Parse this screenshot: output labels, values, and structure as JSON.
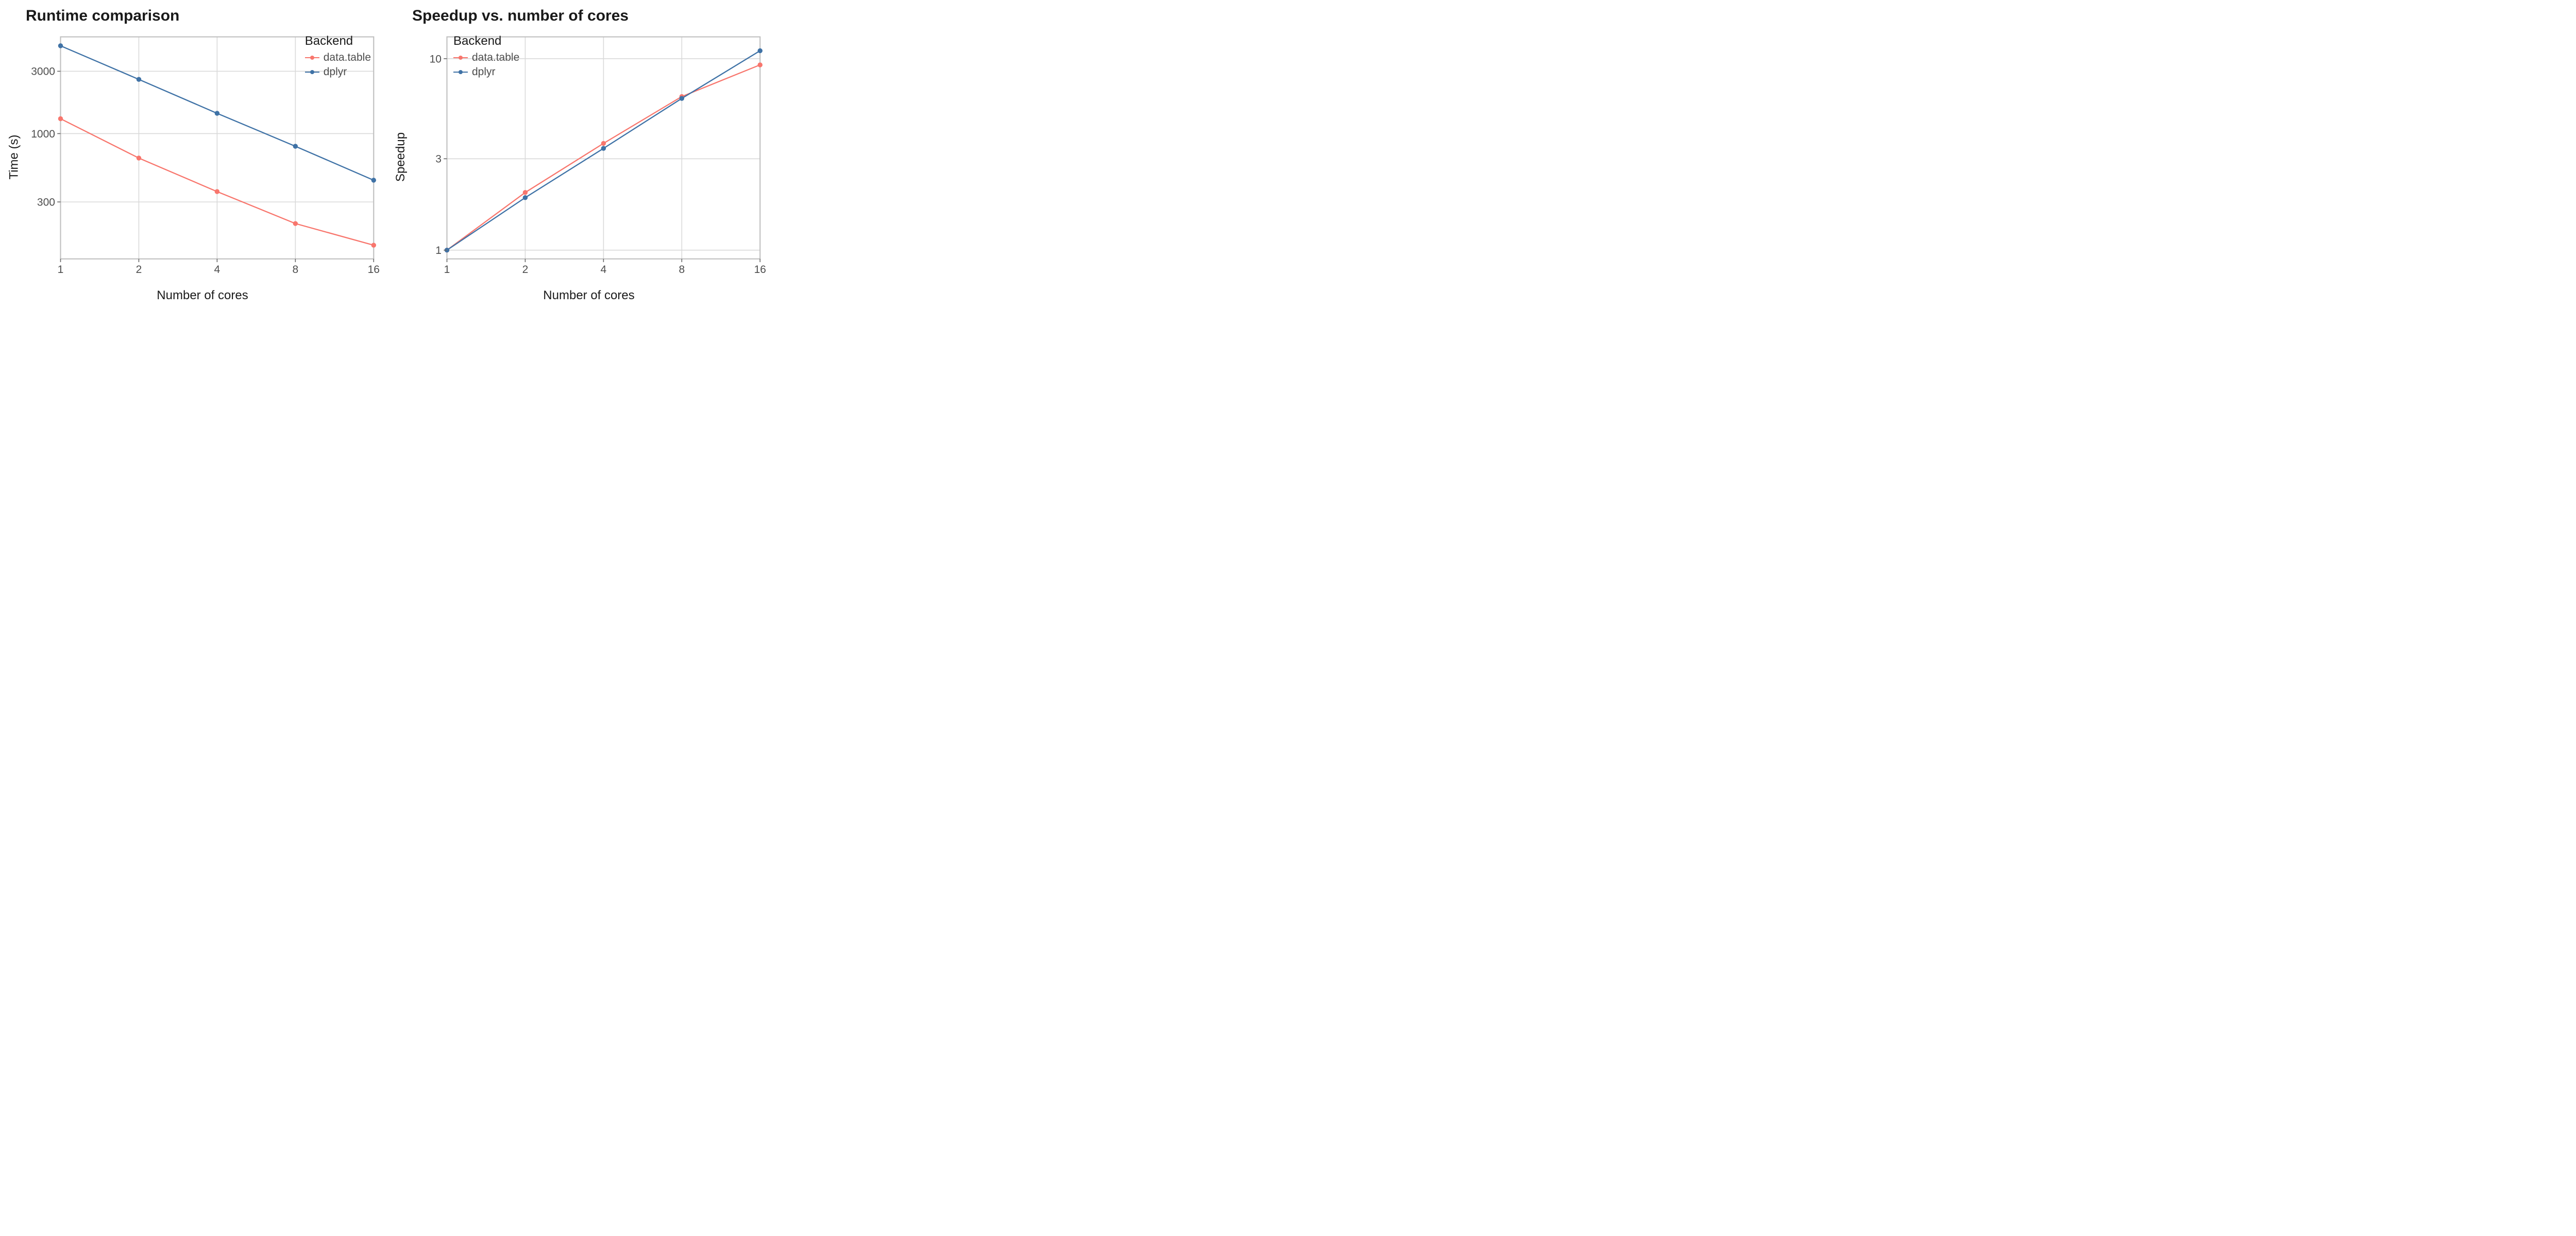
{
  "colors": {
    "data.table": "#F8766D",
    "dplyr": "#3F72A6"
  },
  "x_ticks": [
    1,
    2,
    4,
    8,
    16
  ],
  "chart_data": [
    {
      "type": "line",
      "title": "Runtime comparison",
      "xlabel": "Number of cores",
      "ylabel": "Time (s)",
      "x_log": true,
      "y_log": true,
      "y_ticks": [
        300,
        1000,
        3000
      ],
      "y_range": [
        110,
        5500
      ],
      "legend_title": "Backend",
      "legend_pos": "inside-top-right",
      "series": [
        {
          "name": "data.table",
          "x": [
            1,
            2,
            4,
            8,
            16
          ],
          "y": [
            1300,
            650,
            360,
            205,
            140
          ]
        },
        {
          "name": "dplyr",
          "x": [
            1,
            2,
            4,
            8,
            16
          ],
          "y": [
            4700,
            2600,
            1430,
            800,
            440
          ]
        }
      ]
    },
    {
      "type": "line",
      "title": "Speedup vs. number of cores",
      "xlabel": "Number of cores",
      "ylabel": "Speedup",
      "x_log": true,
      "y_log": true,
      "y_ticks": [
        1,
        3,
        10
      ],
      "y_range": [
        0.9,
        13
      ],
      "legend_title": "Backend",
      "legend_pos": "inside-top-left",
      "series": [
        {
          "name": "data.table",
          "x": [
            1,
            2,
            4,
            8,
            16
          ],
          "y": [
            1.0,
            2.0,
            3.61,
            6.34,
            9.28
          ]
        },
        {
          "name": "dplyr",
          "x": [
            1,
            2,
            4,
            8,
            16
          ],
          "y": [
            1.0,
            1.88,
            3.4,
            6.2,
            11.0
          ]
        }
      ]
    }
  ]
}
